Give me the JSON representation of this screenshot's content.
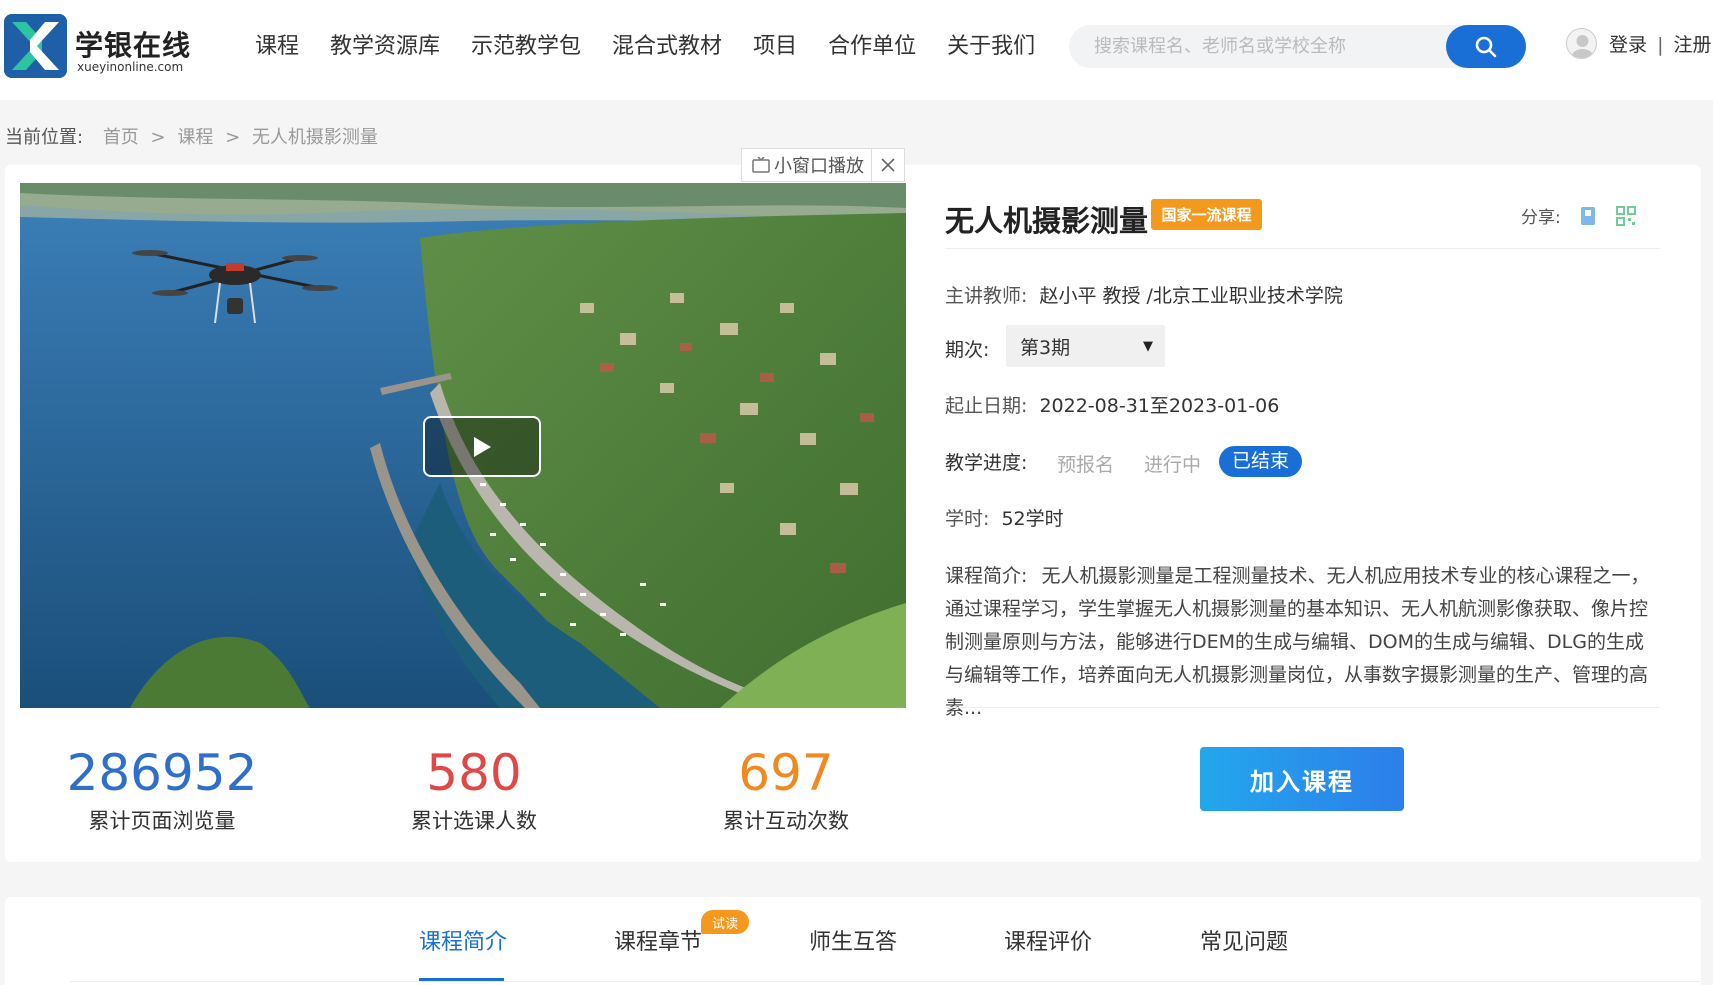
{
  "header": {
    "logo_cn": "学银在线",
    "logo_en": "xueyinonline.com",
    "nav": [
      "课程",
      "教学资源库",
      "示范教学包",
      "混合式教材",
      "项目",
      "合作单位",
      "关于我们"
    ],
    "search_placeholder": "搜索课程名、老师名或学校全称",
    "login": "登录",
    "separator": "|",
    "register": "注册"
  },
  "breadcrumb": {
    "prefix": "当前位置:",
    "items": [
      "首页",
      "课程",
      "无人机摄影测量"
    ],
    "sep": ">"
  },
  "video": {
    "mini_player_label": "小窗口播放"
  },
  "stats": [
    {
      "value": "286952",
      "label": "累计页面浏览量",
      "color": "#2f6fc9"
    },
    {
      "value": "580",
      "label": "累计选课人数",
      "color": "#e04848"
    },
    {
      "value": "697",
      "label": "累计互动次数",
      "color": "#f08a20"
    }
  ],
  "course": {
    "title": "无人机摄影测量",
    "badge": "国家一流课程",
    "share_label": "分享:",
    "teacher_label": "主讲教师:",
    "teacher_value": "赵小平 教授 /北京工业职业技术学院",
    "term_label": "期次:",
    "term_value": "第3期",
    "date_label": "起止日期:",
    "date_value": "2022-08-31至2023-01-06",
    "progress_label": "教学进度:",
    "progress_options": [
      "预报名",
      "进行中",
      "已结束"
    ],
    "hours_label": "学时:",
    "hours_value": "52学时",
    "intro_label": "课程简介:",
    "intro_text": "无人机摄影测量是工程测量技术、无人机应用技术专业的核心课程之一，通过课程学习，学生掌握无人机摄影测量的基本知识、无人机航测影像获取、像片控制测量原则与方法，能够进行DEM的生成与编辑、DOM的生成与编辑、DLG的生成与编辑等工作，培养面向无人机摄影测量岗位，从事数字摄影测量的生产、管理的高素...",
    "join_button": "加入课程"
  },
  "tabs": {
    "items": [
      "课程简介",
      "课程章节",
      "师生互答",
      "课程评价",
      "常见问题"
    ],
    "trial_badge": "试读"
  },
  "colors": {
    "accent": "#1a6fd6",
    "badge": "#f39a1e"
  }
}
